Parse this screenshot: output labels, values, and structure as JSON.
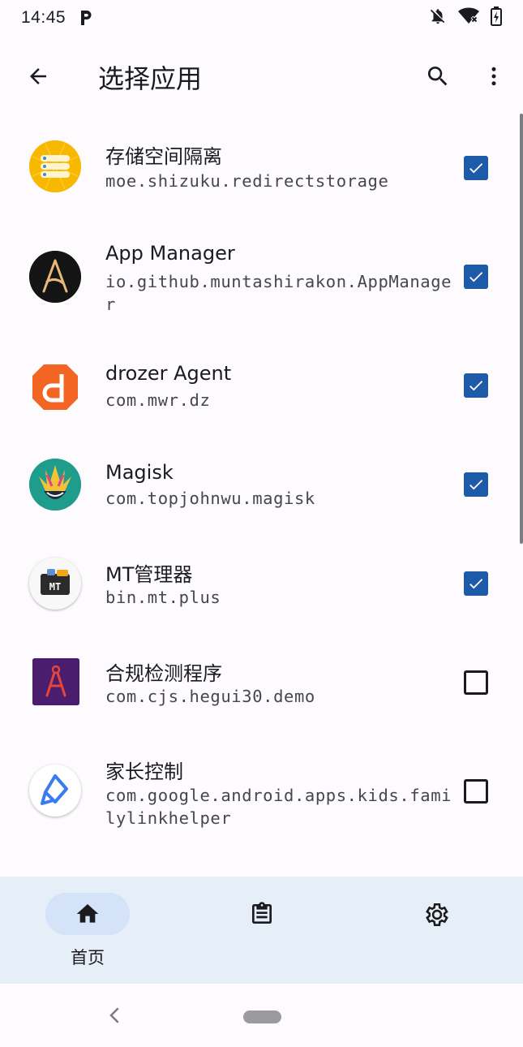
{
  "status_bar": {
    "time": "14:45",
    "icons": [
      "parking-icon",
      "bell-off-icon",
      "wifi-off-icon",
      "battery-charging-icon"
    ]
  },
  "app_bar": {
    "title": "选择应用",
    "icons": [
      "back-arrow-icon",
      "search-icon",
      "more-vert-icon"
    ]
  },
  "apps": [
    {
      "name": "存储空间隔离",
      "package": "moe.shizuku.redirectstorage",
      "checked": true,
      "icon": "storage-redirect-icon"
    },
    {
      "name": "App Manager",
      "package": "io.github.muntashirakon.AppManager",
      "checked": true,
      "icon": "app-manager-icon"
    },
    {
      "name": "drozer Agent",
      "package": "com.mwr.dz",
      "checked": true,
      "icon": "drozer-icon"
    },
    {
      "name": "Magisk",
      "package": "com.topjohnwu.magisk",
      "checked": true,
      "icon": "magisk-icon"
    },
    {
      "name": "MT管理器",
      "package": "bin.mt.plus",
      "checked": true,
      "icon": "mt-manager-icon"
    },
    {
      "name": "合规检测程序",
      "package": "com.cjs.hegui30.demo",
      "checked": false,
      "icon": "compass-tool-icon"
    },
    {
      "name": "家长控制",
      "package": "com.google.android.apps.kids.familylinkhelper",
      "checked": false,
      "icon": "family-link-icon"
    }
  ],
  "bottom_nav": {
    "items": [
      {
        "label": "首页",
        "icon": "home-icon",
        "active": true
      },
      {
        "label": "",
        "icon": "clipboard-icon",
        "active": false
      },
      {
        "label": "",
        "icon": "settings-icon",
        "active": false
      }
    ]
  },
  "colors": {
    "accent": "#1d5ba8",
    "nav_bg": "#e6eef7",
    "nav_pill": "#d4e3f8",
    "background": "#fdfbfd"
  }
}
